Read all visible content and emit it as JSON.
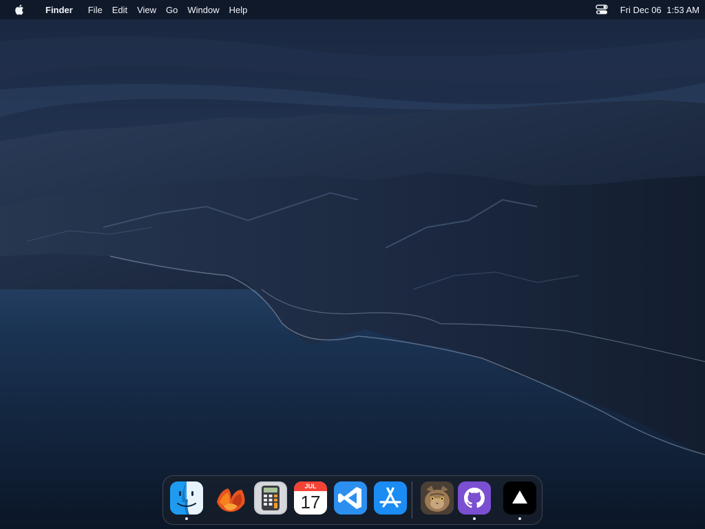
{
  "menubar": {
    "apple_icon": "apple-logo-icon",
    "app_name": "Finder",
    "menus": [
      "File",
      "Edit",
      "View",
      "Go",
      "Window",
      "Help"
    ],
    "control_center_icon": "control-center-icon",
    "clock": {
      "date": "Fri Dec 06",
      "time": "1:53 AM"
    }
  },
  "dock": {
    "apps": [
      {
        "icon": "finder-icon",
        "running": true
      },
      {
        "icon": "macos-ventura-icon",
        "running": false
      },
      {
        "icon": "calculator-icon",
        "running": false
      },
      {
        "icon": "calendar-icon",
        "running": false,
        "month": "JUL",
        "day": "17"
      },
      {
        "icon": "vscode-icon",
        "running": false
      },
      {
        "icon": "app-store-icon",
        "running": false
      },
      {
        "icon": "cat-avatar-icon",
        "running": false
      },
      {
        "icon": "github-icon",
        "running": true
      },
      {
        "icon": "vercel-icon",
        "running": true
      }
    ]
  },
  "colors": {
    "menubar_text": "#f2f4f8",
    "calendar_red": "#f44336",
    "vscode_blue": "#2b8ff0",
    "appstore_blue": "#1a8cf4",
    "github_purple": "#7b4fd1"
  }
}
